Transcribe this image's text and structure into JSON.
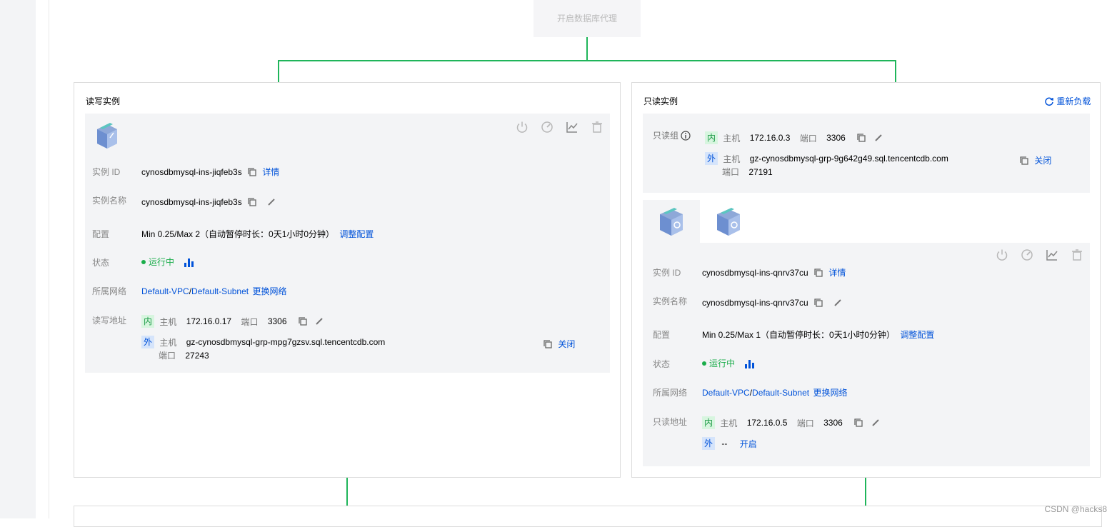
{
  "top": {
    "db_proxy_label": "开启数据库代理"
  },
  "rw": {
    "title": "读写实例",
    "fields": {
      "id_label": "实例 ID",
      "id_value": "cynosdbmysql-ins-jiqfeb3s",
      "details_link": "详情",
      "name_label": "实例名称",
      "name_value": "cynosdbmysql-ins-jiqfeb3s",
      "config_label": "配置",
      "config_value": "Min 0.25/Max 2（自动暂停时长：0天1小时0分钟）",
      "config_link": "调整配置",
      "status_label": "状态",
      "status_value": "运行中",
      "network_label": "所属网络",
      "vpc": "Default-VPC",
      "sep": " /",
      "subnet": "Default-Subnet",
      "change_network": "更换网络",
      "addr_label": "读写地址",
      "in_tag": "内",
      "host_label": "主机",
      "in_host": "172.16.0.17",
      "port_label": "端口",
      "in_port": "3306",
      "out_tag": "外",
      "out_host": "gz-cynosdbmysql-grp-mpg7gzsv.sql.tencentcdb.com",
      "out_port": "27243",
      "close_link": "关闭"
    }
  },
  "ro": {
    "title": "只读实例",
    "rebalance": "重新负载",
    "group": {
      "label": "只读组",
      "in_tag": "内",
      "host_label": "主机",
      "in_host": "172.16.0.3",
      "port_label": "端口",
      "in_port": "3306",
      "out_tag": "外",
      "out_host": "gz-cynosdbmysql-grp-9g642g49.sql.tencentcdb.com",
      "out_port": "27191",
      "close_link": "关闭"
    },
    "fields": {
      "id_label": "实例 ID",
      "id_value": "cynosdbmysql-ins-qnrv37cu",
      "details_link": "详情",
      "name_label": "实例名称",
      "name_value": "cynosdbmysql-ins-qnrv37cu",
      "config_label": "配置",
      "config_value": "Min 0.25/Max 1（自动暂停时长：0天1小时0分钟）",
      "config_link": "调整配置",
      "status_label": "状态",
      "status_value": "运行中",
      "network_label": "所属网络",
      "vpc": "Default-VPC",
      "sep": " /",
      "subnet": "Default-Subnet",
      "change_network": "更换网络",
      "addr_label": "只读地址",
      "in_tag": "内",
      "host_label": "主机",
      "in_host": "172.16.0.5",
      "port_label": "端口",
      "in_port": "3306",
      "out_tag": "外",
      "out_value": "--",
      "open_link": "开启"
    }
  },
  "watermark": "CSDN @hacks8",
  "colors": {
    "link": "#0052d9",
    "running": "#1aad4a",
    "connector": "#1fb55a",
    "card_bg": "#f3f4f6"
  },
  "icons": [
    "power-icon",
    "speed-icon",
    "chart-icon",
    "trash-icon",
    "copy-icon",
    "edit-icon",
    "bar-chart-icon",
    "info-icon",
    "refresh-icon",
    "db-instance-icon"
  ]
}
